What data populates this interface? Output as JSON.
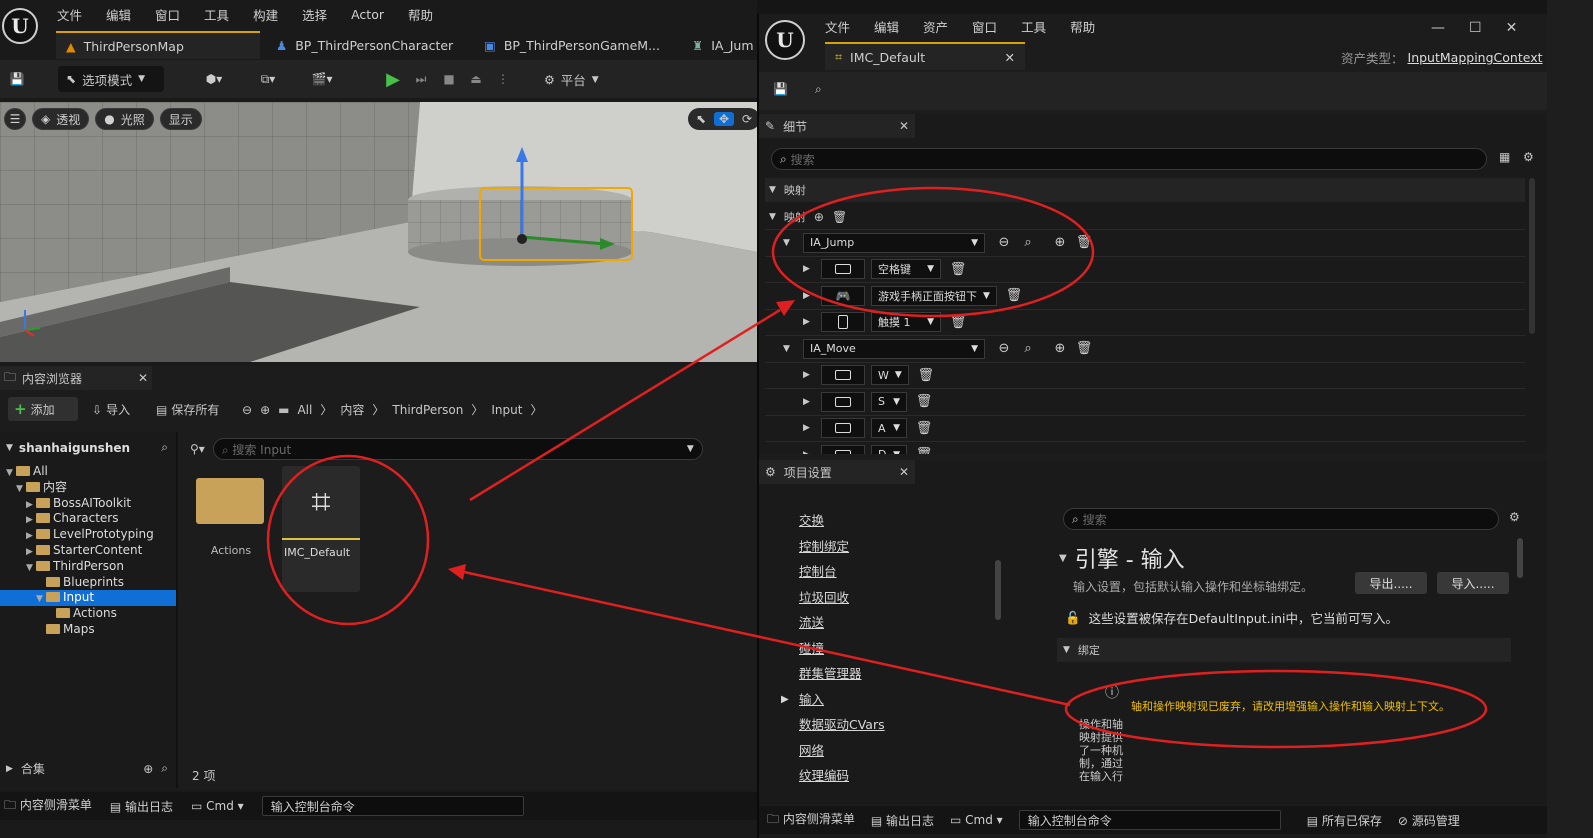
{
  "editor": {
    "menu": [
      "文件",
      "编辑",
      "窗口",
      "工具",
      "构建",
      "选择",
      "Actor",
      "帮助"
    ],
    "tabs": [
      "ThirdPersonMap",
      "BP_ThirdPersonCharacter",
      "BP_ThirdPersonGameM...",
      "IA_Jum"
    ],
    "mode_label": "选项模式",
    "platform_label": "平台",
    "viewport": {
      "perspective": "透视",
      "lighting": "光照",
      "show": "显示"
    }
  },
  "content_browser": {
    "title": "内容浏览器",
    "add_label": "添加",
    "import_label": "导入",
    "save_all_label": "保存所有",
    "breadcrumb": [
      "All",
      "内容",
      "ThirdPerson",
      "Input"
    ],
    "project_name": "shanhaigunshen",
    "search_placeholder": "搜索 Input",
    "tree": [
      {
        "label": "All",
        "depth": 0,
        "open": true
      },
      {
        "label": "内容",
        "depth": 1,
        "open": true
      },
      {
        "label": "BossAIToolkit",
        "depth": 2,
        "open": false
      },
      {
        "label": "Characters",
        "depth": 2,
        "open": false
      },
      {
        "label": "LevelPrototyping",
        "depth": 2,
        "open": false
      },
      {
        "label": "StarterContent",
        "depth": 2,
        "open": false
      },
      {
        "label": "ThirdPerson",
        "depth": 2,
        "open": true
      },
      {
        "label": "Blueprints",
        "depth": 3,
        "open": false
      },
      {
        "label": "Input",
        "depth": 3,
        "open": true,
        "selected": true
      },
      {
        "label": "Actions",
        "depth": 4,
        "open": false
      },
      {
        "label": "Maps",
        "depth": 3,
        "open": false
      }
    ],
    "assets": [
      {
        "label": "Actions",
        "type": "folder"
      },
      {
        "label": "IMC_Default",
        "type": "input-mapping"
      }
    ],
    "collections_label": "合集",
    "item_count": "2 项"
  },
  "bottom_bar": {
    "drawer": "内容侧滑菜单",
    "output_log": "输出日志",
    "cmd": "Cmd",
    "console_placeholder": "输入控制台命令"
  },
  "asset_editor": {
    "menu": [
      "文件",
      "编辑",
      "资产",
      "窗口",
      "工具",
      "帮助"
    ],
    "tab_label": "IMC_Default",
    "asset_type_label": "资产类型：",
    "asset_type_value": "InputMappingContext",
    "details_title": "细节",
    "search_placeholder": "搜索",
    "section_mapping": "映射",
    "mappings_label": "映射",
    "mappings": [
      {
        "action": "IA_Jump",
        "keys": [
          {
            "icon": "keyboard-icon",
            "label": "空格键"
          },
          {
            "icon": "gamepad-icon",
            "label": "游戏手柄正面按钮下"
          },
          {
            "icon": "touch-icon",
            "label": "触摸 1"
          }
        ]
      },
      {
        "action": "IA_Move",
        "keys": [
          {
            "icon": "keyboard-icon",
            "label": "W"
          },
          {
            "icon": "keyboard-icon",
            "label": "S"
          },
          {
            "icon": "keyboard-icon",
            "label": "A"
          },
          {
            "icon": "keyboard-icon",
            "label": "D"
          }
        ]
      }
    ]
  },
  "project_settings": {
    "title": "项目设置",
    "nav": [
      "交换",
      "控制绑定",
      "控制台",
      "垃圾回收",
      "流送",
      "碰撞",
      "群集管理器",
      "输入",
      "数据驱动CVars",
      "网络",
      "纹理编码"
    ],
    "search_placeholder": "搜索",
    "heading": "引擎 - 输入",
    "description": "输入设置，包括默认输入操作和坐标轴绑定。",
    "export_label": "导出.....",
    "import_label": "导入.....",
    "notice": "这些设置被保存在DefaultInput.ini中，它当前可写入。",
    "bindings_label": "绑定",
    "warning": "轴和操作映射现已废弃，请改用增强输入操作和输入映射上下文。",
    "side_text": "操作和轴映射提供了一种机制，通过在输入行"
  },
  "asset_bottom_bar": {
    "drawer": "内容侧滑菜单",
    "output_log": "输出日志",
    "cmd": "Cmd",
    "console_placeholder": "输入控制台命令",
    "saved": "所有已保存",
    "source_control": "源码管理"
  },
  "colors": {
    "annotation": "#e02020",
    "accent": "#d8a300",
    "selection": "#0f6fd6",
    "warning": "#f0c000"
  }
}
